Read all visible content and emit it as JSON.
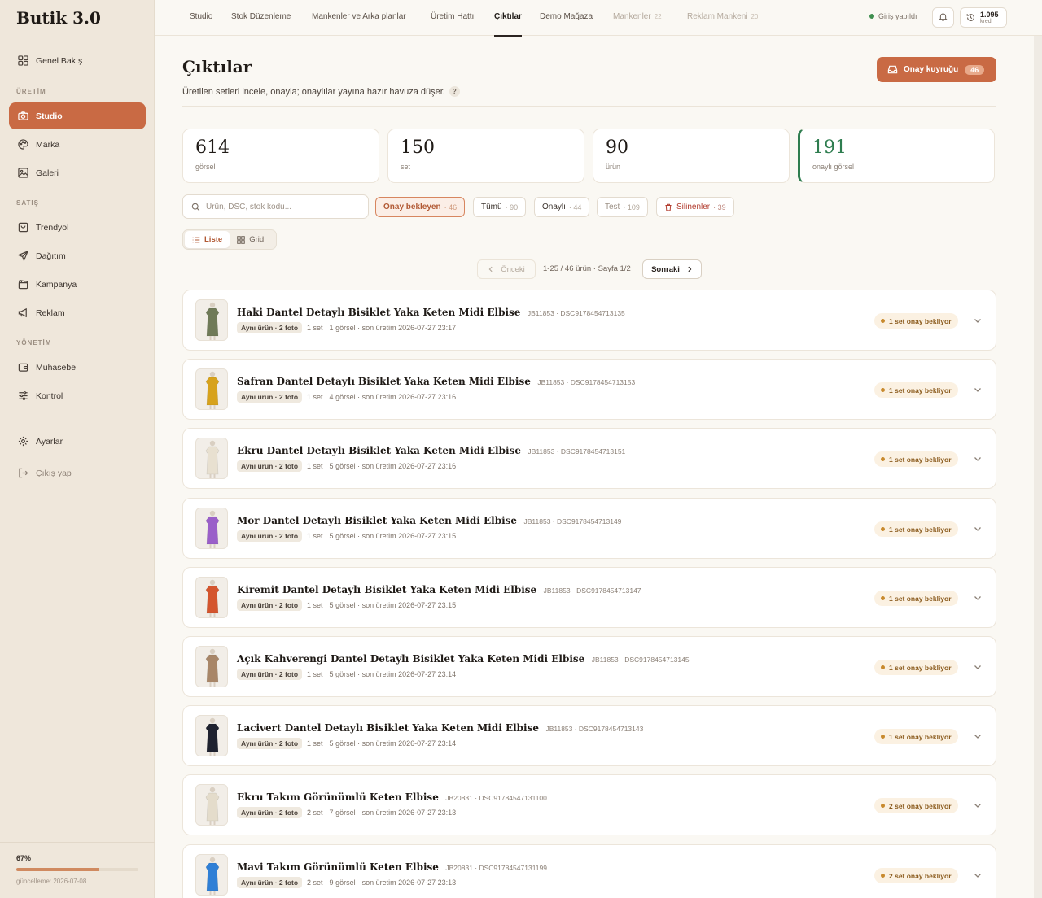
{
  "app": {
    "brand": "Butik 3.0"
  },
  "sidebar": {
    "overview": "Genel Bakış",
    "sections": {
      "production": "ÜRETİM",
      "sales": "SATIŞ",
      "management": "YÖNETİM"
    },
    "production_items": [
      "Studio",
      "Marka",
      "Galeri"
    ],
    "sales_items": [
      "Trendyol",
      "Dağıtım",
      "Kampanya",
      "Reklam"
    ],
    "management_items": [
      "Muhasebe",
      "Kontrol"
    ],
    "settings": "Ayarlar",
    "logout": "Çıkış yap",
    "progress": {
      "pct_label": "67%",
      "fraction": 0.67,
      "note": "güncelleme: 2026-07-08"
    }
  },
  "topnav": {
    "tabs": [
      {
        "label": "Studio"
      },
      {
        "label": "Stok Düzenleme"
      },
      {
        "label": "Mankenler ve Arka planlar"
      },
      {
        "label": "Üretim Hattı"
      },
      {
        "label": "Çıktılar"
      },
      {
        "label": "Demo Mağaza"
      },
      {
        "label": "Mankenler",
        "count": "22"
      },
      {
        "label": "Reklam Mankeni",
        "count": "20"
      }
    ],
    "status": "Giriş yapıldı",
    "credit": {
      "value": "1.095",
      "label": "kredi"
    }
  },
  "header": {
    "title": "Çıktılar",
    "subtitle": "Üretilen setleri incele, onayla; onaylılar yayına hazır havuza düşer.",
    "help": "?",
    "queue_button": "Onay kuyruğu",
    "queue_count": "46"
  },
  "stats": [
    {
      "value": "614",
      "label": "görsel"
    },
    {
      "value": "150",
      "label": "set"
    },
    {
      "value": "90",
      "label": "ürün"
    },
    {
      "value": "191",
      "label": "onaylı görsel"
    }
  ],
  "filters": {
    "search_placeholder": "Ürün, DSC, stok kodu...",
    "chips": [
      {
        "label": "Onay bekleyen",
        "count": "46"
      },
      {
        "label": "Tümü",
        "count": "90"
      },
      {
        "label": "Onaylı",
        "count": "44"
      },
      {
        "label": "Test",
        "count": "109"
      },
      {
        "label": "Silinenler",
        "count": "39"
      }
    ]
  },
  "view": {
    "list": "Liste",
    "grid": "Grid"
  },
  "pager": {
    "prev": "Önceki",
    "info": "1-25 / 46 ürün · Sayfa 1/2",
    "next": "Sonraki"
  },
  "rows": [
    {
      "name": "Haki Dantel Detaylı Bisiklet Yaka Keten Midi Elbise",
      "codes": "JB11853 · DSC9178454713135",
      "tag": "Aynı ürün · 2 foto",
      "meta": "1 set · 1 görsel · son üretim 2026-07-27 23:17",
      "status": "1 set onay bekliyor",
      "color": "#6f7a58"
    },
    {
      "name": "Safran Dantel Detaylı Bisiklet Yaka Keten Midi Elbise",
      "codes": "JB11853 · DSC9178454713153",
      "tag": "Aynı ürün · 2 foto",
      "meta": "1 set · 4 görsel · son üretim 2026-07-27 23:16",
      "status": "1 set onay bekliyor",
      "color": "#d7a21c"
    },
    {
      "name": "Ekru Dantel Detaylı Bisiklet Yaka Keten Midi Elbise",
      "codes": "JB11853 · DSC9178454713151",
      "tag": "Aynı ürün · 2 foto",
      "meta": "1 set · 5 görsel · son üretim 2026-07-27 23:16",
      "status": "1 set onay bekliyor",
      "color": "#e8e0d0"
    },
    {
      "name": "Mor Dantel Detaylı Bisiklet Yaka Keten Midi Elbise",
      "codes": "JB11853 · DSC9178454713149",
      "tag": "Aynı ürün · 2 foto",
      "meta": "1 set · 5 görsel · son üretim 2026-07-27 23:15",
      "status": "1 set onay bekliyor",
      "color": "#9a5fc9"
    },
    {
      "name": "Kiremit Dantel Detaylı Bisiklet Yaka Keten Midi Elbise",
      "codes": "JB11853 · DSC9178454713147",
      "tag": "Aynı ürün · 2 foto",
      "meta": "1 set · 5 görsel · son üretim 2026-07-27 23:15",
      "status": "1 set onay bekliyor",
      "color": "#d4552e"
    },
    {
      "name": "Açık Kahverengi Dantel Detaylı Bisiklet Yaka Keten Midi Elbise",
      "codes": "JB11853 · DSC9178454713145",
      "tag": "Aynı ürün · 2 foto",
      "meta": "1 set · 5 görsel · son üretim 2026-07-27 23:14",
      "status": "1 set onay bekliyor",
      "color": "#a88668"
    },
    {
      "name": "Lacivert Dantel Detaylı Bisiklet Yaka Keten Midi Elbise",
      "codes": "JB11853 · DSC9178454713143",
      "tag": "Aynı ürün · 2 foto",
      "meta": "1 set · 5 görsel · son üretim 2026-07-27 23:14",
      "status": "1 set onay bekliyor",
      "color": "#1f2230"
    },
    {
      "name": "Ekru Takım Görünümlü Keten Elbise",
      "codes": "JB20831 · DSC91784547131100",
      "tag": "Aynı ürün · 2 foto",
      "meta": "2 set · 7 görsel · son üretim 2026-07-27 23:13",
      "status": "2 set onay bekliyor",
      "color": "#e4dccb"
    },
    {
      "name": "Mavi Takım Görünümlü Keten Elbise",
      "codes": "JB20831 · DSC91784547131199",
      "tag": "Aynı ürün · 2 foto",
      "meta": "2 set · 9 görsel · son üretim 2026-07-27 23:13",
      "status": "2 set onay bekliyor",
      "color": "#2f7fd6"
    }
  ],
  "colors": {
    "accent": "#c96a44",
    "approved": "#2e7d4f",
    "pending": "#c88a2e"
  }
}
